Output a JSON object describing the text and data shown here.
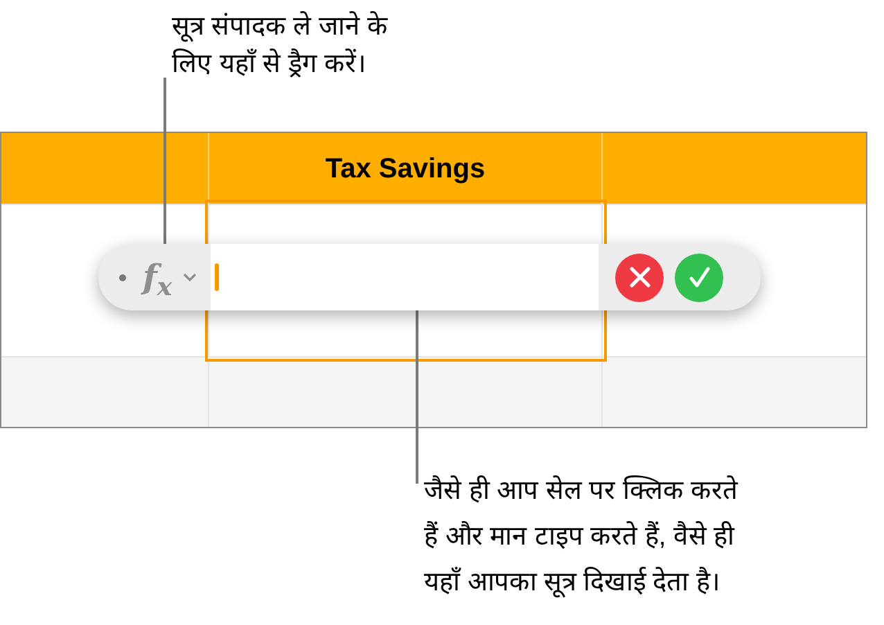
{
  "callouts": [
    {
      "text": "सूत्र संपादक ले जाने के\nलिए यहाँ से ड्रैग करें।"
    },
    {
      "text": "जैसे ही आप सेल पर क्लिक करते\nहैं और मान टाइप करते हैं, वैसे ही\nयहाँ आपका सूत्र दिखाई देता है।"
    }
  ],
  "table": {
    "header_cell": "Tax Savings",
    "cell_below_header_selected": true
  },
  "formula_editor": {
    "function_label": "f$_{x}$",
    "buttons": [
      {
        "kind": "cancel"
      },
      {
        "kind": "accept"
      }
    ]
  }
}
